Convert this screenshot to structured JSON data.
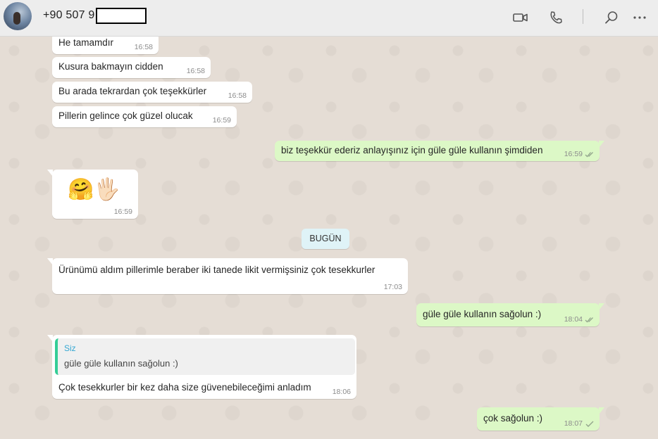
{
  "header": {
    "contact": "+90 507 9",
    "icons": [
      "video-call-icon",
      "voice-call-icon",
      "search-icon",
      "menu-icon"
    ]
  },
  "messages": [
    {
      "text": "He tamamdır",
      "time": "16:58"
    },
    {
      "text": "Kusura bakmayın  cidden",
      "time": "16:58"
    },
    {
      "text": "Bu arada tekrardan çok teşekkürler",
      "time": "16:58"
    },
    {
      "text": "Pillerin gelince çok güzel olucak",
      "time": "16:59"
    },
    {
      "text": "biz teşekkür ederiz anlayışınız için güle güle kullanın şimdiden",
      "time": "16:59"
    },
    {
      "emoji": "🤗🖐🏻",
      "time": "16:59"
    },
    {
      "text": "Ürünümü aldım pillerimle beraber iki tanede likit vermişsiniz çok tesekkurler",
      "time": "17:03"
    },
    {
      "text": "güle güle kullanın sağolun :)",
      "time": "18:04"
    },
    {
      "quote_author": "Siz",
      "quote_text": "güle güle kullanın sağolun :)",
      "text": "Çok tesekkurler bir kez daha size güvenebileceğimi anladım",
      "time": "18:06"
    },
    {
      "text": "çok sağolun :)",
      "time": "18:07"
    }
  ],
  "day_separator": "BUGÜN",
  "colors": {
    "incoming": "#ffffff",
    "outgoing": "#dcf8c6",
    "read_tick": "#4fc3f7",
    "sent_tick": "#92a58c",
    "quote_author": "#35a8d3"
  }
}
